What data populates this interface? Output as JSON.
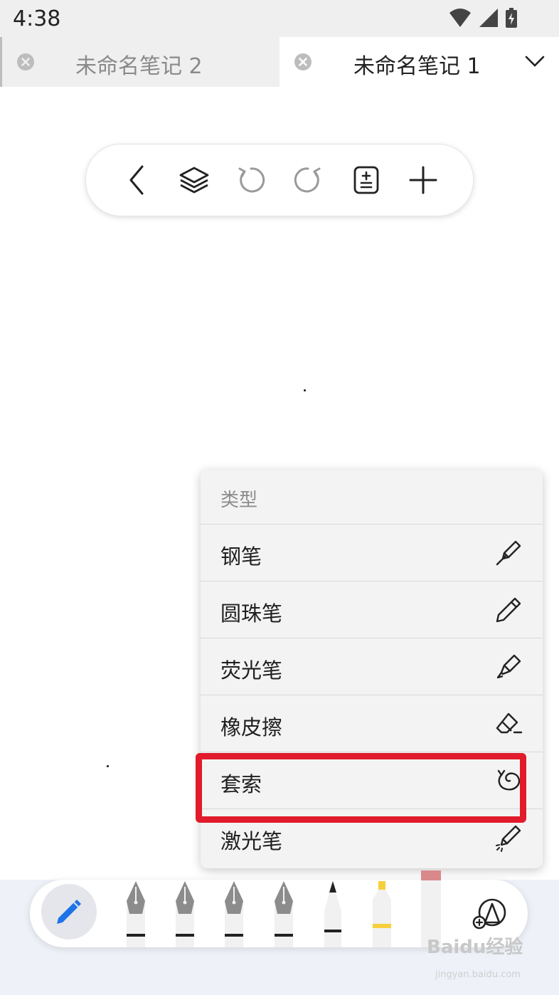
{
  "status_bar": {
    "time": "4:38"
  },
  "tabs": [
    {
      "label": "未命名笔记 2",
      "active": false
    },
    {
      "label": "未命名笔记 1",
      "active": true
    }
  ],
  "toolbar": {
    "buttons": [
      "back-icon",
      "layers-icon",
      "undo-icon",
      "redo-icon",
      "page-adjust-icon",
      "add-icon"
    ]
  },
  "menu": {
    "header": "类型",
    "items": [
      {
        "label": "钢笔",
        "icon": "fountain-pen-icon"
      },
      {
        "label": "圆珠笔",
        "icon": "ballpoint-pen-icon"
      },
      {
        "label": "荧光笔",
        "icon": "highlighter-icon"
      },
      {
        "label": "橡皮擦",
        "icon": "eraser-icon"
      },
      {
        "label": "套索",
        "icon": "lasso-icon",
        "highlighted": true
      },
      {
        "label": "激光笔",
        "icon": "laser-pointer-icon"
      }
    ]
  },
  "watermark": {
    "text": "Baidu经验",
    "sub": "jingyan.baidu.com"
  },
  "colors": {
    "accent_blue": "#1e73e8",
    "highlight_red": "#e11b2b",
    "highlighter_yellow": "#f6cf3b",
    "marker_pink": "#f2b8b8"
  }
}
